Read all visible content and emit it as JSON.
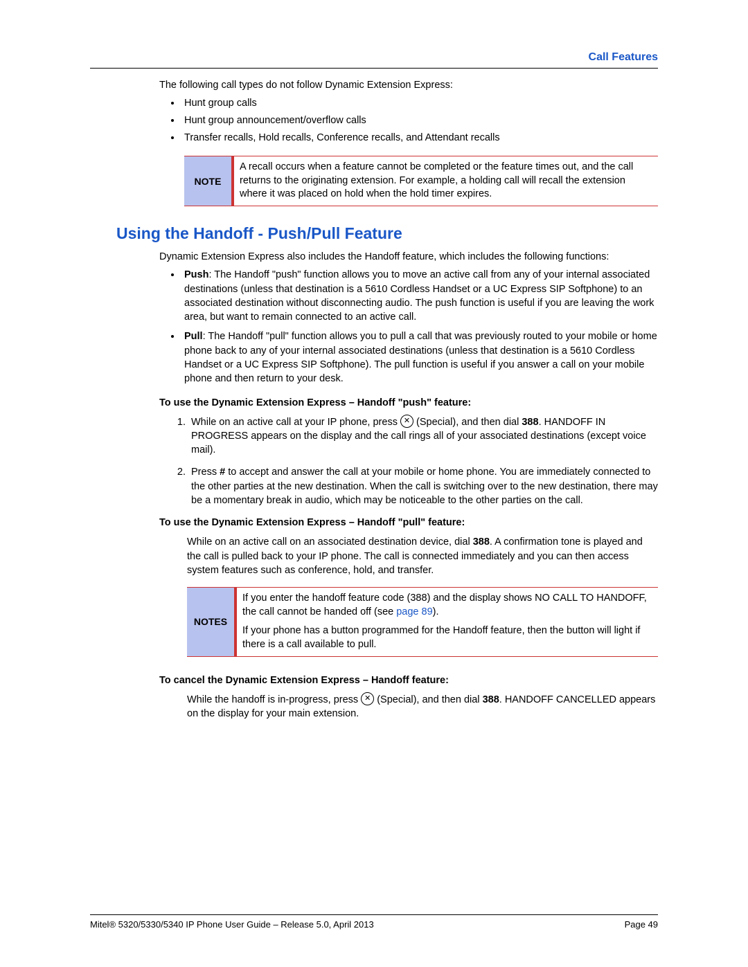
{
  "header": {
    "section": "Call Features"
  },
  "intro": "The following call types do not follow Dynamic Extension Express:",
  "excluded": [
    "Hunt group calls",
    "Hunt group announcement/overflow calls",
    "Transfer recalls, Hold recalls, Conference recalls, and Attendant recalls"
  ],
  "note1": {
    "label": "NOTE",
    "text": "A recall occurs when a feature cannot be completed or the feature times out, and the call returns to the originating extension. For example, a holding call will recall the extension where it was placed on hold when the hold timer expires."
  },
  "section_title": "Using the Handoff - Push/Pull Feature",
  "dee_intro": "Dynamic Extension Express also includes the Handoff feature, which includes the following functions:",
  "push": {
    "lead": "Push",
    "text": ": The Handoff \"push\" function allows you to move an active call from any of your internal associated destinations (unless that destination is a 5610 Cordless Handset or a UC Express SIP Softphone) to an associated destination without disconnecting audio. The push function is useful if you are leaving the work area, but want to remain connected to an active call."
  },
  "pull": {
    "lead": "Pull",
    "text": ": The Handoff \"pull\" function allows you to pull a call that was previously routed to your mobile or home phone back to any of your internal associated destinations (unless that destination is a 5610 Cordless Handset or a UC Express SIP Softphone). The pull function is useful if you answer a call on your mobile phone and then return to your desk."
  },
  "push_head": "To use the Dynamic Extension Express – Handoff \"push\" feature:",
  "push_steps": {
    "s1a": "While on an active call at your IP phone, press ",
    "s1b": " (Special), and then dial ",
    "s1code": "388",
    "s1c": ". HANDOFF IN PROGRESS appears on the display and the call rings all of your associated destinations (except voice mail).",
    "s2a": "Press ",
    "s2key": "#",
    "s2b": " to accept and answer the call at your mobile or home phone. You are immediately connected to the other parties at the new destination. When the call is switching over to the new destination, there may be a momentary break in audio, which may be noticeable to the other parties on the call."
  },
  "pull_head": "To use the Dynamic Extension Express – Handoff \"pull\" feature:",
  "pull_para": {
    "a": "While on an active call on an associated destination device, dial ",
    "code": "388",
    "b": ". A confirmation tone is played and the call is pulled back to your IP phone. The call is connected immediately and you can then access system features such as conference, hold, and transfer."
  },
  "note2": {
    "label": "NOTES",
    "p1a": "If you enter the handoff feature code (388) and the display shows NO CALL TO HANDOFF, the call cannot be handed off (see ",
    "p1link": "page 89",
    "p1b": ").",
    "p2": "If your phone has a button programmed for the Handoff feature, then the button will light if there is a call available to pull."
  },
  "cancel_head": "To cancel the Dynamic Extension Express – Handoff feature:",
  "cancel_para": {
    "a": "While the handoff is in-progress, press ",
    "b": " (Special), and then dial ",
    "code": "388",
    "c": ". HANDOFF CANCELLED appears on the display for your main extension."
  },
  "footer": {
    "left": "Mitel® 5320/5330/5340 IP Phone User Guide – Release 5.0, April 2013",
    "right": "Page 49"
  }
}
